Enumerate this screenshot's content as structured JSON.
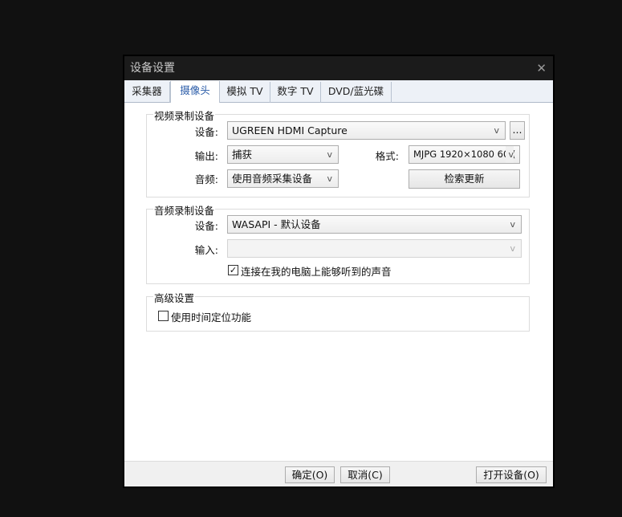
{
  "dialog": {
    "title": "设备设置",
    "close_icon": "close-icon"
  },
  "tabs": [
    {
      "label": "采集器",
      "active": false
    },
    {
      "label": "摄像头",
      "active": true
    },
    {
      "label": "模拟 TV",
      "active": false
    },
    {
      "label": "数字 TV",
      "active": false
    },
    {
      "label": "DVD/蓝光碟",
      "active": false
    }
  ],
  "video_group": {
    "legend": "视频录制设备",
    "device_label": "设备:",
    "device_value": "UGREEN HDMI Capture",
    "more_button": "...",
    "output_label": "输出:",
    "output_value": "捕获",
    "format_label": "格式:",
    "format_value": "MJPG 1920×1080 60.(",
    "audio_label": "音频:",
    "audio_value": "使用音频采集设备",
    "refresh_button": "检索更新"
  },
  "audio_group": {
    "legend": "音频录制设备",
    "device_label": "设备:",
    "device_value": "WASAPI - 默认设备",
    "input_label": "输入:",
    "input_value": "",
    "loopback_label": "连接在我的电脑上能够听到的声音",
    "loopback_checked": true
  },
  "advanced_group": {
    "legend": "高级设置",
    "timeshift_label": "使用时间定位功能",
    "timeshift_checked": false
  },
  "footer": {
    "ok": "确定(O)",
    "cancel": "取消(C)",
    "open_device": "打开设备(O)"
  },
  "dropdown_glyph": "v",
  "check_glyph": "✓"
}
